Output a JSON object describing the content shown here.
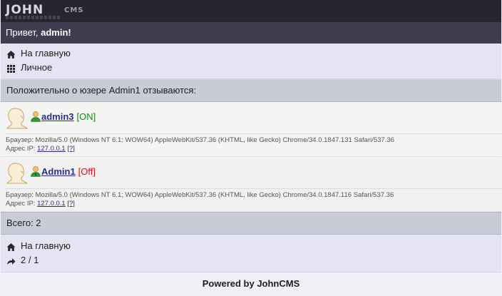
{
  "header": {
    "logo_main": "JOHN",
    "logo_sub": "CMS"
  },
  "greeting": {
    "prefix": "Привет, ",
    "user": "admin!"
  },
  "menu": [
    {
      "label": "На главную",
      "icon": "home-icon"
    },
    {
      "label": "Личное",
      "icon": "grid-icon"
    }
  ],
  "section_title": "Положительно о юзере Admin1 отзываются:",
  "entries": [
    {
      "username": "admin3",
      "status": "[ON]",
      "browser_label": "Браузер: ",
      "browser": "Mozilla/5.0 (Windows NT 6.1; WOW64) AppleWebKit/537.36 (KHTML, like Gecko) Chrome/34.0.1847.131 Safari/537.36",
      "ip_label": "Адрес IP: ",
      "ip": "127.0.0.1",
      "ip_help": "[?]"
    },
    {
      "username": "Admin1",
      "status": "[Off]",
      "browser_label": "Браузер: ",
      "browser": "Mozilla/5.0 (Windows NT 6.1; WOW64) AppleWebKit/537.36 (KHTML, like Gecko) Chrome/34.0.1847.116 Safari/537.36",
      "ip_label": "Адрес IP: ",
      "ip": "127.0.0.1",
      "ip_help": "[?]"
    }
  ],
  "total": "Всего: 2",
  "bottom_menu": [
    {
      "label": "На главную",
      "icon": "home-icon"
    },
    {
      "label": "2 / 1",
      "icon": "forward-arrow-icon"
    }
  ],
  "footer": "Powered by JohnCMS",
  "colors": {
    "header_bg": "#262631",
    "greet_bg": "#3e3e50",
    "menu_bg": "#e4e4f5",
    "status_on": "#0c8d0c",
    "status_off": "#dd0f22",
    "link": "#2e2c8c"
  }
}
